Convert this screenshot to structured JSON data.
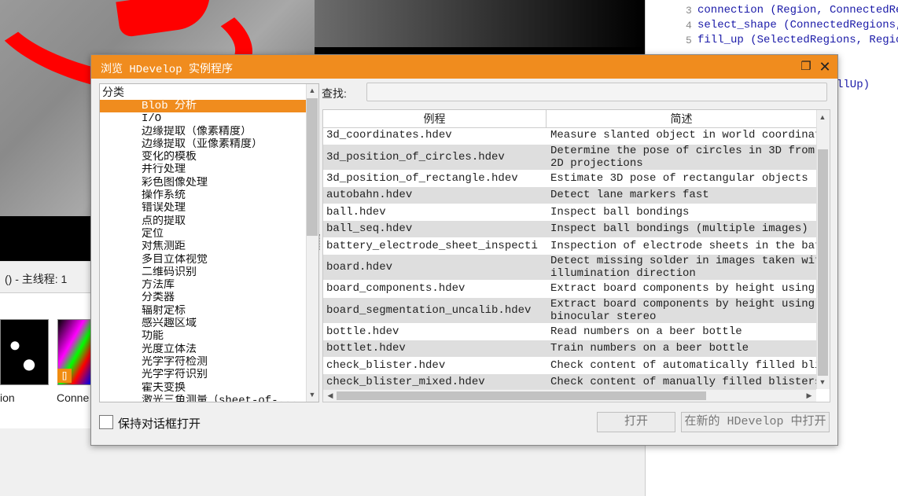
{
  "background": {
    "status_text": "() - 主线程: 1",
    "thumb_labels": [
      "ion",
      "Conne"
    ],
    "thumb_badge": "[]",
    "code_lines": [
      {
        "no": "3",
        "text": "connection (Region, ConnectedRe"
      },
      {
        "no": "4",
        "text": "select_shape (ConnectedRegions,"
      },
      {
        "no": "5",
        "text": "fill_up (SelectedRegions, Regio"
      }
    ],
    "code_fragment": "llUp)"
  },
  "dialog": {
    "title": "浏览 HDevelop 实例程序",
    "restore_glyph": "❐",
    "close_glyph": "✕",
    "category_header": "分类",
    "categories": [
      "Blob 分析",
      "I/O",
      "边缘提取（像素精度）",
      "边缘提取（亚像素精度）",
      "变化的模板",
      "并行处理",
      "彩色图像处理",
      "操作系统",
      "错误处理",
      "点的提取",
      "定位",
      "对焦测距",
      "多目立体视觉",
      "二维码识别",
      "方法库",
      "分类器",
      "辐射定标",
      "感兴趣区域",
      "功能",
      "光度立体法",
      "光学字符检测",
      "光学字符识别",
      "霍夫变换",
      "激光三角测量（sheet-of-..."
    ],
    "search_label": "查找:",
    "search_value": "",
    "columns": {
      "name": "例程",
      "desc": "简述"
    },
    "examples": [
      {
        "name": "3d_coordinates.hdev",
        "desc": "Measure slanted object in world coordinate"
      },
      {
        "name": "3d_position_of_circles.hdev",
        "desc": "Determine the pose of circles in 3D from t",
        "desc2": "2D projections"
      },
      {
        "name": "3d_position_of_rectangle.hdev",
        "desc": "Estimate 3D pose of rectangular objects"
      },
      {
        "name": "autobahn.hdev",
        "desc": "Detect lane markers fast"
      },
      {
        "name": "ball.hdev",
        "desc": "Inspect ball bondings"
      },
      {
        "name": "ball_seq.hdev",
        "desc": "Inspect ball bondings (multiple images)"
      },
      {
        "name": "battery_electrode_sheet_inspecti",
        "desc": "Inspection of electrode sheets in the batt"
      },
      {
        "name": "board.hdev",
        "desc": "Detect missing solder in images taken with",
        "desc2": "illumination direction"
      },
      {
        "name": "board_components.hdev",
        "desc": "Extract board components by height using b"
      },
      {
        "name": "board_segmentation_uncalib.hdev",
        "desc": "Extract board components by height using u",
        "desc2": "binocular stereo"
      },
      {
        "name": "bottle.hdev",
        "desc": "Read numbers on a beer bottle"
      },
      {
        "name": "bottlet.hdev",
        "desc": "Train numbers on a beer bottle"
      },
      {
        "name": "check_blister.hdev",
        "desc": "Check content of automatically filled blis"
      },
      {
        "name": "check_blister_mixed.hdev",
        "desc": "Check content of manually filled blisters"
      }
    ],
    "keep_open_label": "保持对话框打开",
    "open_label": "打开",
    "open_new_label": "在新的 HDevelop 中打开"
  }
}
